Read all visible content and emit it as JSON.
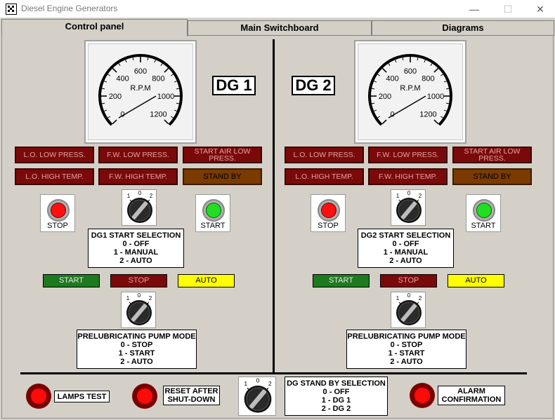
{
  "window": {
    "title": "Diesel Engine Generators",
    "minimize": "—",
    "maximize": "☐",
    "close": "✕"
  },
  "tabs": [
    "Control panel",
    "Main Switchboard",
    "Diagrams"
  ],
  "gauge": {
    "unit": "R.P.M",
    "ticks": [
      "0",
      "200",
      "400",
      "600",
      "800",
      "1000",
      "1200"
    ]
  },
  "dg1": {
    "label": "DG 1",
    "alarms": [
      "L.O. LOW PRESS.",
      "F.W. LOW PRESS.",
      "START AIR LOW PRESS.",
      "L.O. HIGH TEMP.",
      "F.W. HIGH TEMP.",
      "STAND BY"
    ],
    "stop_label": "STOP",
    "start_label": "START",
    "selector_marks": [
      "1",
      "0",
      "2"
    ],
    "selection": {
      "title": "DG1 START SELECTION",
      "lines": [
        "0 - OFF",
        "1 - MANUAL",
        "2 - AUTO"
      ]
    },
    "status": [
      "START",
      "STOP",
      "AUTO"
    ],
    "prelub": {
      "title": "PRELUBRICATING PUMP MODE",
      "lines": [
        "0 - STOP",
        "1 - START",
        "2 - AUTO"
      ]
    }
  },
  "dg2": {
    "label": "DG 2",
    "alarms": [
      "L.O. LOW PRESS.",
      "F.W. LOW PRESS.",
      "START AIR LOW PRESS.",
      "L.O. HIGH TEMP.",
      "F.W. HIGH TEMP.",
      "STAND BY"
    ],
    "stop_label": "STOP",
    "start_label": "START",
    "selector_marks": [
      "1",
      "0",
      "2"
    ],
    "selection": {
      "title": "DG2 START SELECTION",
      "lines": [
        "0 - OFF",
        "1 - MANUAL",
        "2 - AUTO"
      ]
    },
    "status": [
      "START",
      "STOP",
      "AUTO"
    ],
    "prelub": {
      "title": "PRELUBRICATING PUMP MODE",
      "lines": [
        "0 - STOP",
        "1 - START",
        "2 - AUTO"
      ]
    }
  },
  "bottom": {
    "lamps_test": "LAMPS TEST",
    "reset": [
      "RESET AFTER",
      "SHUT-DOWN"
    ],
    "standby_marks": [
      "1",
      "0",
      "2"
    ],
    "standby_selection": {
      "title": "DG STAND BY SELECTION",
      "lines": [
        "0 - OFF",
        "1 - DG 1",
        "2 - DG 2"
      ]
    },
    "alarm_conf": [
      "ALARM",
      "CONFIRMATION"
    ]
  },
  "colors": {
    "alarm": "#7a0a0a",
    "standby": "#7a3a00",
    "start_green": "#1e7a1e",
    "stop_red": "#7a0a0a",
    "auto_yellow": "#ffff00",
    "background": "#d4d0c8"
  }
}
